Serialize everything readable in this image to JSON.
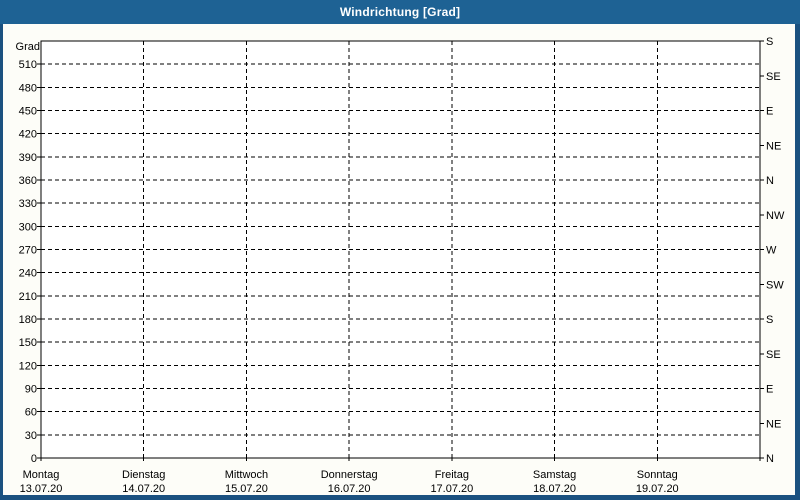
{
  "window": {
    "title": "Windrichtung [Grad]"
  },
  "colors": {
    "frame_border": "#1B5180",
    "titlebar_bg": "#1E6294",
    "titlebar_text": "#FFFFFF",
    "panel_bg": "#FDFDF8",
    "plot_bg": "#FFFFFF",
    "plot_border": "#000000",
    "grid": "#000000",
    "label_text": "#000000"
  },
  "chart_data": {
    "type": "line",
    "title": "Windrichtung [Grad]",
    "ylabel": "Grad",
    "ylim": [
      0,
      540
    ],
    "y_tick_step": 30,
    "y_ticks": [
      510,
      480,
      450,
      420,
      390,
      360,
      330,
      300,
      270,
      240,
      210,
      180,
      150,
      120,
      90,
      60,
      30,
      0
    ],
    "grid_style": "dashed",
    "right_axis": {
      "tick_step_degrees": 45,
      "ticks": [
        {
          "value": 540,
          "label": "S"
        },
        {
          "value": 495,
          "label": "SE"
        },
        {
          "value": 450,
          "label": "E"
        },
        {
          "value": 405,
          "label": "NE"
        },
        {
          "value": 360,
          "label": "N"
        },
        {
          "value": 315,
          "label": "NW"
        },
        {
          "value": 270,
          "label": "W"
        },
        {
          "value": 225,
          "label": "SW"
        },
        {
          "value": 180,
          "label": "S"
        },
        {
          "value": 135,
          "label": "SE"
        },
        {
          "value": 90,
          "label": "E"
        },
        {
          "value": 45,
          "label": "NE"
        },
        {
          "value": 0,
          "label": "N"
        }
      ]
    },
    "x_axis": {
      "days": [
        {
          "name": "Montag",
          "date": "13.07.20"
        },
        {
          "name": "Dienstag",
          "date": "14.07.20"
        },
        {
          "name": "Mittwoch",
          "date": "15.07.20"
        },
        {
          "name": "Donnerstag",
          "date": "16.07.20"
        },
        {
          "name": "Freitag",
          "date": "17.07.20"
        },
        {
          "name": "Samstag",
          "date": "18.07.20"
        },
        {
          "name": "Sonntag",
          "date": "19.07.20"
        }
      ]
    },
    "series": [],
    "legend": null
  }
}
